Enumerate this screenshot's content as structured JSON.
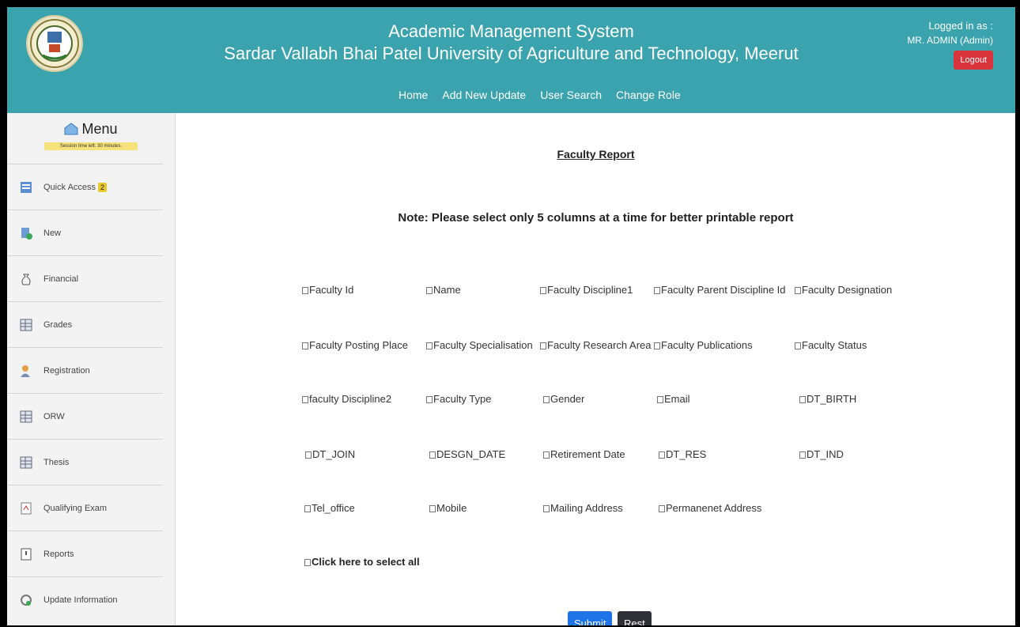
{
  "header": {
    "title_line1": "Academic Management System",
    "title_line2": "Sardar Vallabh Bhai Patel University of Agriculture and Technology, Meerut",
    "nav": [
      "Home",
      "Add New Update",
      "User Search",
      "Change Role"
    ],
    "logged_in_label": "Logged in as :",
    "user": "MR. ADMIN (Admin)",
    "logout_label": "Logout",
    "colors": {
      "header_bg": "#3aa3ad",
      "logout_bg": "#d9343e"
    }
  },
  "sidebar": {
    "menu_title": "Menu",
    "session_text": "Session time left: 30 minutes.",
    "items": [
      {
        "label": "Quick Access",
        "badge": "2",
        "icon": "quick-access-icon"
      },
      {
        "label": "New",
        "icon": "new-document-icon"
      },
      {
        "label": "Financial",
        "icon": "money-bag-icon"
      },
      {
        "label": "Grades",
        "icon": "grid-icon"
      },
      {
        "label": "Registration",
        "icon": "user-icon"
      },
      {
        "label": "ORW",
        "icon": "grid-icon"
      },
      {
        "label": "Thesis",
        "icon": "grid-icon"
      },
      {
        "label": "Qualifying Exam",
        "icon": "pdf-icon"
      },
      {
        "label": "Reports",
        "icon": "report-icon"
      },
      {
        "label": "Update Information",
        "icon": "refresh-user-icon"
      }
    ]
  },
  "main": {
    "report_title": "Faculty Report",
    "note": "Note: Please select only 5 columns at a time for better printable report",
    "columns": [
      [
        "Faculty Id",
        "Name",
        "Faculty Discipline1",
        "Faculty Parent Discipline Id",
        "Faculty Designation"
      ],
      [
        "Faculty Posting Place",
        "Faculty Specialisation",
        "Faculty Research Area",
        "Faculty Publications",
        "Faculty Status"
      ],
      [
        "faculty Discipline2",
        "Faculty Type",
        "Gender",
        "Email",
        "DT_BIRTH"
      ],
      [
        "DT_JOIN",
        "DESGN_DATE",
        "Retirement Date",
        "DT_RES",
        "DT_IND"
      ],
      [
        "Tel_office",
        "Mobile",
        "Mailing Address",
        "Permanenet Address"
      ]
    ],
    "select_all_label": "Click here to select all",
    "submit_label": "Submit",
    "reset_label": "Rest"
  }
}
